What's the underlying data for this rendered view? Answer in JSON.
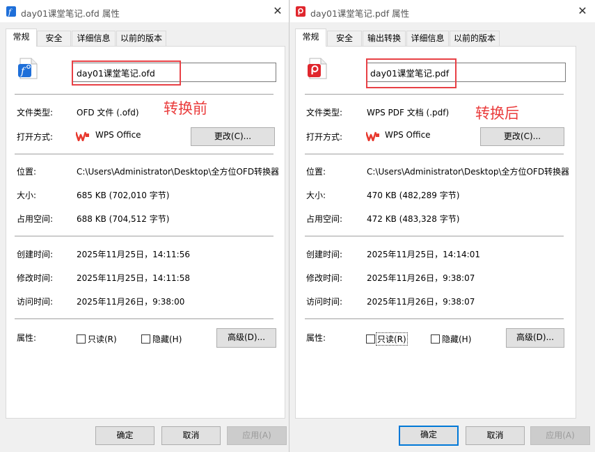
{
  "left": {
    "title": "day01课堂笔记.ofd 属性",
    "tabs": [
      "常规",
      "安全",
      "详细信息",
      "以前的版本"
    ],
    "filename": "day01课堂笔记.ofd",
    "annotation": "转换前",
    "labels": {
      "type": "文件类型:",
      "opens_with": "打开方式:",
      "location": "位置:",
      "size": "大小:",
      "size_on_disk": "占用空间:",
      "created": "创建时间:",
      "modified": "修改时间:",
      "accessed": "访问时间:",
      "attributes": "属性:"
    },
    "values": {
      "type": "OFD 文件 (.ofd)",
      "opens_with": "WPS Office",
      "location": "C:\\Users\\Administrator\\Desktop\\全方位OFD转换器",
      "size": "685 KB (702,010 字节)",
      "size_on_disk": "688 KB (704,512 字节)",
      "created": "2025年11月25日，14:11:56",
      "modified": "2025年11月25日，14:11:58",
      "accessed": "2025年11月26日，9:38:00"
    },
    "buttons": {
      "change": "更改(C)...",
      "advanced": "高级(D)...",
      "ok": "确定",
      "cancel": "取消",
      "apply": "应用(A)"
    },
    "checkboxes": {
      "readonly": "只读(R)",
      "hidden": "隐藏(H)"
    }
  },
  "right": {
    "title": "day01课堂笔记.pdf 属性",
    "tabs": [
      "常规",
      "安全",
      "输出转换",
      "详细信息",
      "以前的版本"
    ],
    "filename": "day01课堂笔记.pdf",
    "annotation": "转换后",
    "labels": {
      "type": "文件类型:",
      "opens_with": "打开方式:",
      "location": "位置:",
      "size": "大小:",
      "size_on_disk": "占用空间:",
      "created": "创建时间:",
      "modified": "修改时间:",
      "accessed": "访问时间:",
      "attributes": "属性:"
    },
    "values": {
      "type": "WPS PDF 文档 (.pdf)",
      "opens_with": "WPS Office",
      "location": "C:\\Users\\Administrator\\Desktop\\全方位OFD转换器",
      "size": "470 KB (482,289 字节)",
      "size_on_disk": "472 KB (483,328 字节)",
      "created": "2025年11月25日，14:14:01",
      "modified": "2025年11月26日，9:38:07",
      "accessed": "2025年11月26日，9:38:07"
    },
    "buttons": {
      "change": "更改(C)...",
      "advanced": "高级(D)...",
      "ok": "确定",
      "cancel": "取消",
      "apply": "应用(A)"
    },
    "checkboxes": {
      "readonly": "只读(R)",
      "hidden": "隐藏(H)"
    }
  },
  "colors": {
    "annotation_red": "#ea3c3c",
    "ofd_blue": "#1e6fd9",
    "pdf_red": "#e0262d",
    "wps_red": "#e83a2f",
    "focus_blue": "#0078d7"
  },
  "icons": {
    "left_title": "ofd-file-icon",
    "right_title": "pdf-file-icon",
    "close": "close-icon",
    "opens_with": "wps-logo-icon"
  }
}
